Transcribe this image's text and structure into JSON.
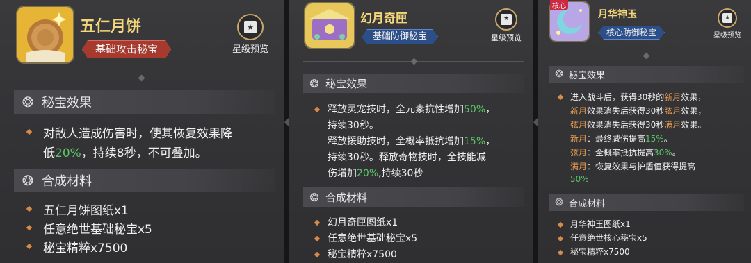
{
  "panels": [
    {
      "name": "五仁月饼",
      "tag": "基础攻击秘宝",
      "star_preview": "星级预览",
      "effect_title": "秘宝效果",
      "effect_lines": [
        [
          {
            "t": "对敌人造成伤害时，使其恢复效果降"
          }
        ],
        [
          {
            "t": "低"
          },
          {
            "t": "20%",
            "c": "green"
          },
          {
            "t": "，持续8秒，不可叠加。"
          }
        ]
      ],
      "material_title": "合成材料",
      "materials": [
        "五仁月饼图纸x1",
        "任意绝世基础秘宝x5",
        "秘宝精粹x7500"
      ]
    },
    {
      "name": "幻月奇匣",
      "tag": "基础防御秘宝",
      "star_preview": "星级预览",
      "effect_title": "秘宝效果",
      "effect_lines": [
        [
          {
            "t": "释放灵宠技时，全元素抗性增加"
          },
          {
            "t": "50%",
            "c": "green"
          },
          {
            "t": "，"
          }
        ],
        [
          {
            "t": "持续30秒。"
          }
        ],
        [
          {
            "t": "释放援助技时，全概率抵抗增加"
          },
          {
            "t": "15%",
            "c": "green"
          },
          {
            "t": "，"
          }
        ],
        [
          {
            "t": "持续30秒。释放奇物技时，全技能减"
          }
        ],
        [
          {
            "t": "伤增加"
          },
          {
            "t": "20%",
            "c": "green"
          },
          {
            "t": ",持续30秒"
          }
        ]
      ],
      "material_title": "合成材料",
      "materials": [
        "幻月奇匣图纸x1",
        "任意绝世基础秘宝x5",
        "秘宝精粹x7500"
      ]
    },
    {
      "name": "月华神玉",
      "core_badge": "核心",
      "tag": "核心防御秘宝",
      "star_preview": "星级预览",
      "effect_title": "秘宝效果",
      "effect_lines": [
        [
          {
            "t": "进入战斗后，获得30秒的"
          },
          {
            "t": "新月",
            "c": "orange"
          },
          {
            "t": "效果，"
          }
        ],
        [
          {
            "t": "新月",
            "c": "orange"
          },
          {
            "t": "效果消失后获得30秒"
          },
          {
            "t": "弦月",
            "c": "orange"
          },
          {
            "t": "效果，"
          }
        ],
        [
          {
            "t": "弦月",
            "c": "orange"
          },
          {
            "t": "效果消失后获得30秒"
          },
          {
            "t": "满月",
            "c": "orange"
          },
          {
            "t": "效果。"
          }
        ],
        [
          {
            "t": "新月",
            "c": "orange"
          },
          {
            "t": "：最终减伤提高"
          },
          {
            "t": "15%",
            "c": "green"
          },
          {
            "t": "。"
          }
        ],
        [
          {
            "t": "弦月",
            "c": "orange"
          },
          {
            "t": "：全概率抵抗提高"
          },
          {
            "t": "30%",
            "c": "green"
          },
          {
            "t": "。"
          }
        ],
        [
          {
            "t": "满月",
            "c": "orange"
          },
          {
            "t": "：恢复效果与护盾值获得提高"
          }
        ],
        [
          {
            "t": "50%",
            "c": "green"
          }
        ]
      ],
      "material_title": "合成材料",
      "materials": [
        "月华神玉图纸x1",
        "任意绝世核心秘宝x5",
        "秘宝精粹x7500"
      ]
    }
  ]
}
